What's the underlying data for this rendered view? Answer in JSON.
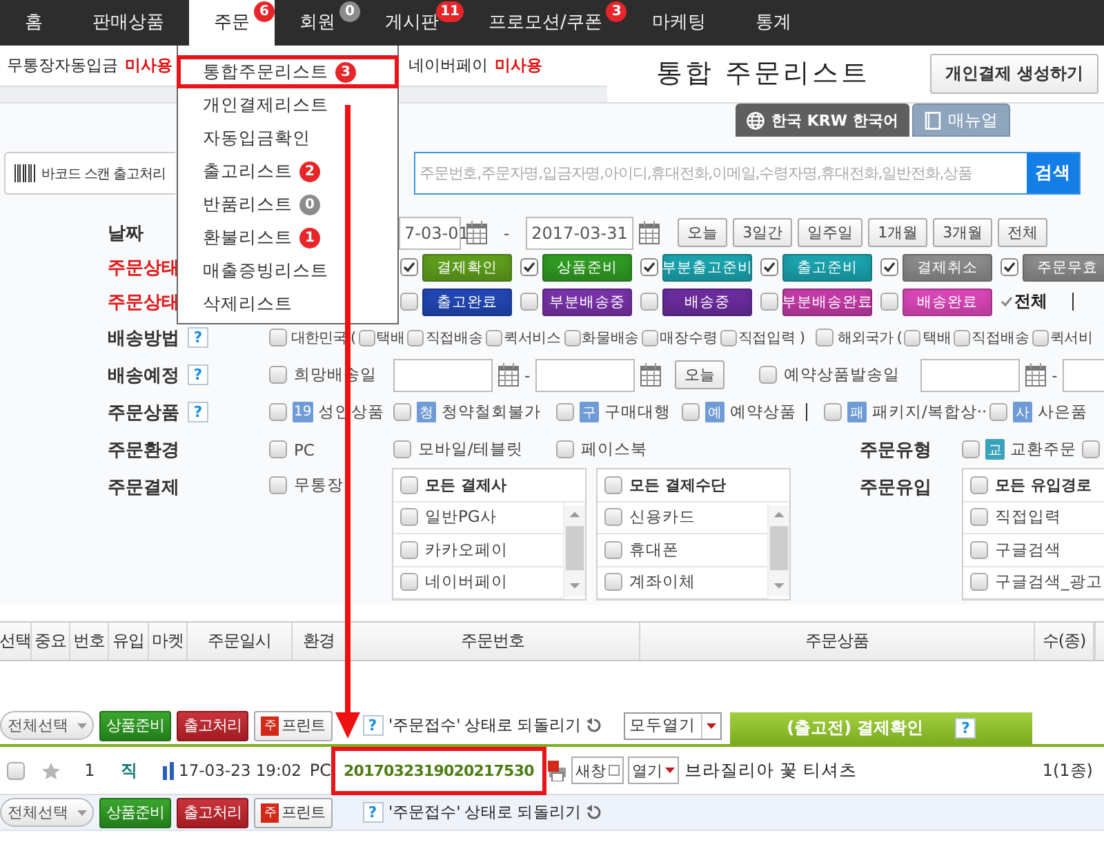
{
  "nav": [
    {
      "label": "홈",
      "selected": false
    },
    {
      "label": "판매상품",
      "selected": false
    },
    {
      "label": "주문",
      "selected": true,
      "badge": {
        "text": "6",
        "color": "#e8262a"
      }
    },
    {
      "label": "회원",
      "selected": false,
      "badge": {
        "text": "0",
        "color": "#8c8c8c"
      }
    },
    {
      "label": "게시판",
      "selected": false,
      "badge": {
        "text": "11",
        "color": "#e8262a"
      }
    },
    {
      "label": "프로모션/쿠폰",
      "selected": false,
      "badge": {
        "text": "3",
        "color": "#e8262a"
      }
    },
    {
      "label": "마케팅",
      "selected": false
    },
    {
      "label": "통계",
      "selected": false
    }
  ],
  "order_menu": [
    {
      "label": "통합주문리스트",
      "highlighted": true,
      "badge": {
        "text": "3",
        "color": "#e8262a"
      }
    },
    {
      "label": "개인결제리스트",
      "highlighted": false
    },
    {
      "label": "자동입금확인",
      "highlighted": false
    },
    {
      "label": "출고리스트",
      "highlighted": false,
      "badge": {
        "text": "2",
        "color": "#e8262a"
      }
    },
    {
      "label": "반품리스트",
      "highlighted": false,
      "badge": {
        "text": "0",
        "color": "#8c8c8c"
      }
    },
    {
      "label": "환불리스트",
      "highlighted": false,
      "badge": {
        "text": "1",
        "color": "#e8262a"
      }
    },
    {
      "label": "매출증빙리스트",
      "highlighted": false
    },
    {
      "label": "삭제리스트",
      "highlighted": false
    }
  ],
  "settings_status": [
    {
      "label": "무통장자동입금",
      "value": "미사용"
    },
    {
      "label": "네이버페이",
      "value": "미사용"
    }
  ],
  "page_title": "통합 주문리스트",
  "create_button": "개인결제 생성하기",
  "locale_button": "한국 KRW 한국어",
  "manual_button": "매뉴얼",
  "barcode_button": "바코드 스캔 출고처리",
  "search": {
    "placeholder": "주문번호,주문자명,입금자명,아이디,휴대전화,이메일,수령자명,휴대전화,일반전화,상품",
    "button": "검색"
  },
  "filters": {
    "date": {
      "label": "날짜",
      "from": "7-03-01",
      "separator": "-",
      "to": "2017-03-31",
      "presets": [
        "오늘",
        "3일간",
        "일주일",
        "1개월",
        "3개월",
        "전체"
      ]
    },
    "order_status": [
      {
        "label": "주문상태",
        "items": [
          {
            "label": "결제확인",
            "checked": true,
            "color": "#5e9d1c"
          },
          {
            "label": "상품준비",
            "checked": true,
            "color": "#2f9a22"
          },
          {
            "label": "부분출고준비",
            "checked": true,
            "color": "#1aa2ad"
          },
          {
            "label": "출고준비",
            "checked": true,
            "color": "#1aa2ad"
          },
          {
            "label": "결제취소",
            "checked": true,
            "color": "#8a8a8a"
          },
          {
            "label": "주문무효",
            "checked": true,
            "color": "#8a8a8a"
          }
        ]
      },
      {
        "label": "주문상태",
        "items": [
          {
            "label": "출고완료",
            "checked": false,
            "color": "#2246b2"
          },
          {
            "label": "부분배송중",
            "checked": false,
            "color": "#7732a6"
          },
          {
            "label": "배송중",
            "checked": false,
            "color": "#6a2c9c"
          },
          {
            "label": "부분배송완료",
            "checked": false,
            "color": "#c13aa6"
          },
          {
            "label": "배송완료",
            "checked": false,
            "color": "#d846b6"
          }
        ],
        "all": {
          "label": "전체",
          "checked": true
        }
      }
    ],
    "shipping_method": {
      "label": "배송방법",
      "help": "?",
      "groups": [
        {
          "label": "대한민국",
          "checked": false,
          "open": "(",
          "close": ")",
          "options": [
            {
              "label": "택배",
              "checked": false
            },
            {
              "label": "직접배송",
              "checked": false
            },
            {
              "label": "퀵서비스",
              "checked": false
            },
            {
              "label": "화물배송",
              "checked": false
            },
            {
              "label": "매장수령",
              "checked": false
            },
            {
              "label": "직접입력",
              "checked": false
            }
          ]
        },
        {
          "label": "해외국가",
          "checked": false,
          "open": "(",
          "options": [
            {
              "label": "택배",
              "checked": false
            },
            {
              "label": "직접배송",
              "checked": false
            },
            {
              "label": "퀵서비",
              "checked": false
            }
          ]
        }
      ]
    },
    "shipping_schedule": {
      "label": "배송예정",
      "help": "?",
      "wish": {
        "label": "희망배송일",
        "checked": false,
        "separator": "-"
      },
      "today": "오늘",
      "reserve": {
        "label": "예약상품발송일",
        "checked": false,
        "separator": "-"
      }
    },
    "products": {
      "label": "주문상품",
      "help": "?",
      "options": [
        {
          "tag": "19",
          "color": "#6f9bd6",
          "label": "성인상품",
          "checked": false
        },
        {
          "tag": "청",
          "color": "#6f9bd6",
          "label": "청약철회불가",
          "checked": false
        },
        {
          "tag": "구",
          "color": "#6f9bd6",
          "label": "구매대행",
          "checked": false
        },
        {
          "tag": "예",
          "color": "#6f9bd6",
          "label": "예약상품",
          "checked": false
        },
        {
          "tag": "패",
          "color": "#6f9bd6",
          "label": "패키지/복합상··",
          "checked": false
        },
        {
          "tag": "사",
          "color": "#6f9bd6",
          "label": "사은품",
          "checked": false
        }
      ]
    },
    "environment": {
      "label": "주문환경",
      "options": [
        {
          "label": "PC",
          "checked": false
        },
        {
          "label": "모바일/테블릿",
          "checked": false
        },
        {
          "label": "페이스북",
          "checked": false
        }
      ]
    },
    "order_type": {
      "label": "주문유형",
      "options": [
        {
          "tag": "교",
          "color": "#3aa3bb",
          "label": "교환주문",
          "checked": false
        },
        {
          "checked": false
        }
      ]
    },
    "payment": {
      "label": "주문결제",
      "options": [
        {
          "label": "무통장",
          "checked": false
        }
      ],
      "lists": [
        {
          "header": "모든 결제사",
          "checked": false,
          "items": [
            {
              "label": "일반PG사",
              "checked": false
            },
            {
              "label": "카카오페이",
              "checked": false
            },
            {
              "label": "네이버페이",
              "checked": false
            }
          ]
        },
        {
          "header": "모든 결제수단",
          "checked": false,
          "items": [
            {
              "label": "신용카드",
              "checked": false
            },
            {
              "label": "휴대폰",
              "checked": false
            },
            {
              "label": "계좌이체",
              "checked": false
            }
          ]
        }
      ]
    },
    "inflow": {
      "label": "주문유입",
      "list": {
        "header": "모든 유입경로",
        "checked": false,
        "items": [
          {
            "label": "직접입력",
            "checked": false
          },
          {
            "label": "구글검색",
            "checked": false
          },
          {
            "label": "구글검색_광고",
            "checked": false
          }
        ]
      }
    }
  },
  "table": {
    "columns": [
      "선택",
      "중요",
      "번호",
      "유입",
      "마켓",
      "주문일시",
      "환경",
      "주문번호",
      "주문상품",
      "수(종)"
    ],
    "actions_top": {
      "select_all": "전체선택",
      "buttons": [
        {
          "label": "상품준비",
          "kind": "prepare"
        },
        {
          "label": "출고처리",
          "kind": "ship"
        },
        {
          "label": "프린트",
          "kind": "print",
          "tag": "주"
        }
      ],
      "help": "?",
      "revert": "'주문접수' 상태로 되돌리기",
      "open_all": "모두열기",
      "group_tab": {
        "label": "(출고전) 결제확인",
        "help": "?"
      }
    },
    "rows": [
      {
        "checked": false,
        "starred": false,
        "number": "1",
        "inflow": "직",
        "date": "17-03-23 19:02",
        "env": "PC",
        "order_no": "2017032319020217530",
        "highlighted": true,
        "new_window": "새창",
        "open": "열기",
        "product": "브라질리아 꽃 티셔츠",
        "qty": "1(1종)"
      }
    ],
    "actions_bottom": {
      "select_all": "전체선택",
      "buttons": [
        {
          "label": "상품준비",
          "kind": "prepare"
        },
        {
          "label": "출고처리",
          "kind": "ship"
        },
        {
          "label": "프린트",
          "kind": "print",
          "tag": "주"
        }
      ],
      "help": "?",
      "revert": "'주문접수' 상태로 되돌리기"
    }
  }
}
